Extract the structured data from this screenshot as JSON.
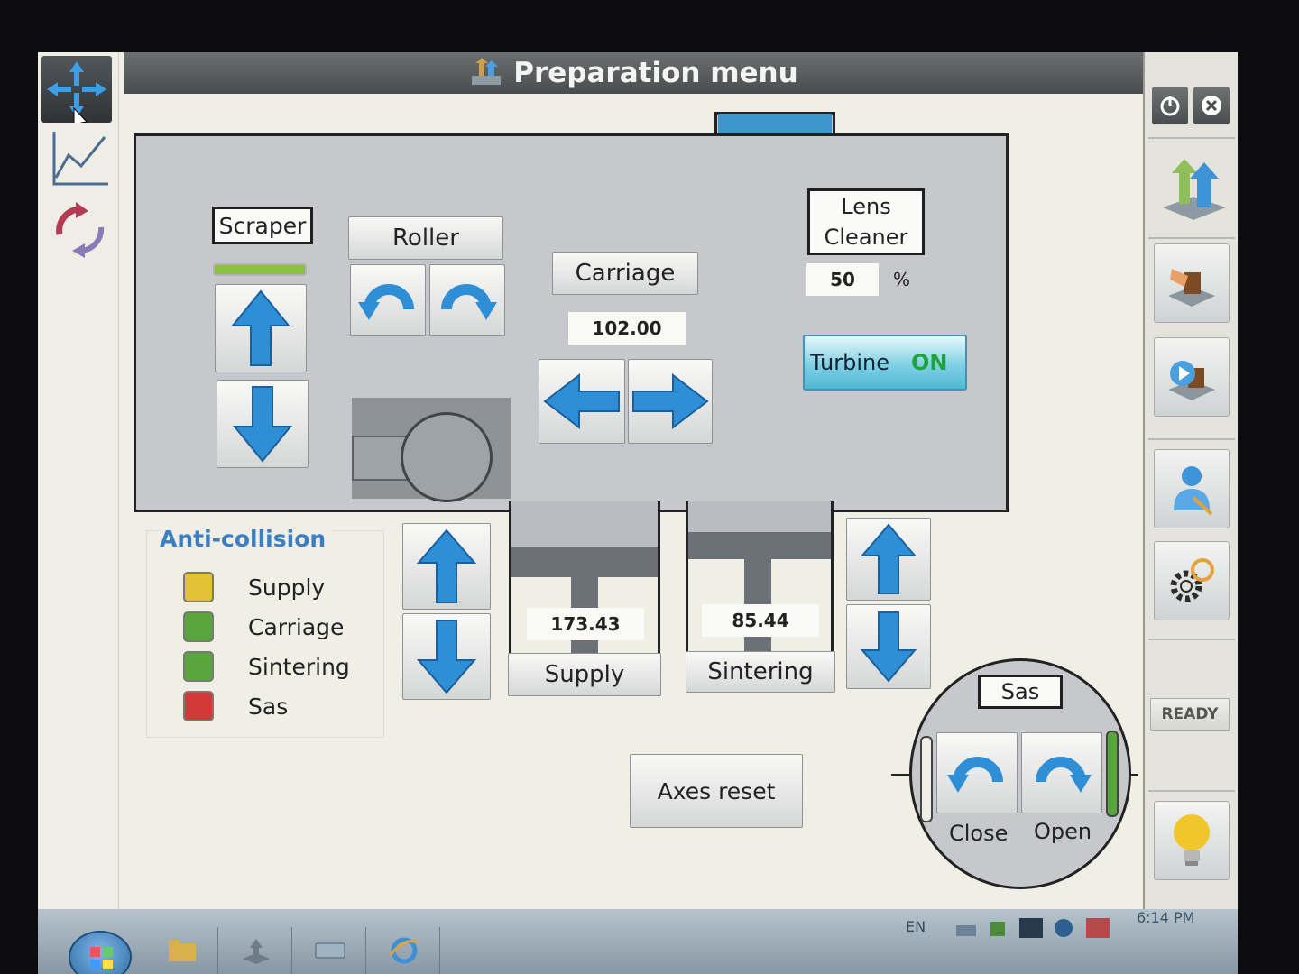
{
  "title": "Preparation menu",
  "scraper": {
    "label": "Scraper"
  },
  "roller": {
    "label": "Roller"
  },
  "carriage": {
    "label": "Carriage",
    "value": "102.00"
  },
  "lens_cleaner": {
    "label_line1": "Lens",
    "label_line2": "Cleaner",
    "value": "50",
    "unit": "%"
  },
  "turbine": {
    "label": "Turbine",
    "state": "ON"
  },
  "anti_collision": {
    "title": "Anti-collision",
    "items": [
      {
        "label": "Supply",
        "color": "#e3c23a"
      },
      {
        "label": "Carriage",
        "color": "#5aa63e"
      },
      {
        "label": "Sintering",
        "color": "#5aa63e"
      },
      {
        "label": "Sas",
        "color": "#d23a3a"
      }
    ]
  },
  "supply": {
    "label": "Supply",
    "value": "173.43"
  },
  "sintering": {
    "label": "Sintering",
    "value": "85.44"
  },
  "axes_reset": {
    "label": "Axes reset"
  },
  "sas": {
    "label": "Sas",
    "close_label": "Close",
    "open_label": "Open"
  },
  "status": {
    "label": "READY"
  },
  "taskbar": {
    "language": "EN",
    "time": "6:14 PM"
  },
  "colors": {
    "arrow_blue": "#2f8fd6",
    "turbine_on": "#1ea43c",
    "accent": "#3d95cc"
  }
}
